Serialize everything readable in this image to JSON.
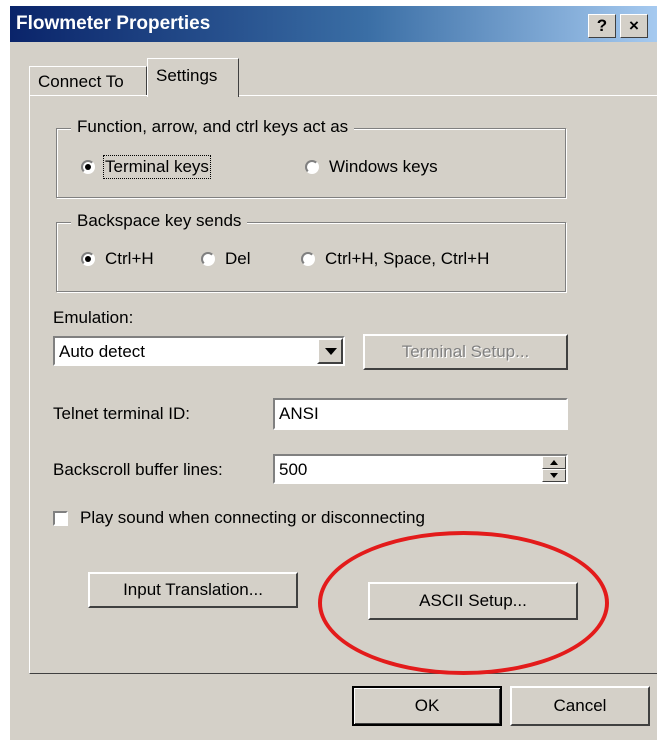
{
  "window": {
    "title": "Flowmeter Properties",
    "help_glyph": "?",
    "close_glyph": "×"
  },
  "tabs": [
    {
      "label": "Connect To",
      "active": false
    },
    {
      "label": "Settings",
      "active": true
    }
  ],
  "keys_group": {
    "legend": "Function, arrow, and ctrl keys act as",
    "options": [
      {
        "label": "Terminal keys",
        "accel": "T",
        "selected": true
      },
      {
        "label": "Windows keys",
        "accel": "W",
        "selected": false
      }
    ]
  },
  "backspace_group": {
    "legend": "Backspace key sends",
    "options": [
      {
        "label": "Ctrl+H",
        "selected": true
      },
      {
        "label": "Del",
        "selected": false
      },
      {
        "label": "Ctrl+H, Space, Ctrl+H",
        "selected": false
      }
    ]
  },
  "emulation": {
    "label": "Emulation:",
    "value": "Auto detect",
    "setup_button": "Terminal Setup..."
  },
  "telnet": {
    "label": "Telnet terminal ID:",
    "value": "ANSI"
  },
  "backscroll": {
    "label": "Backscroll buffer lines:",
    "value": "500"
  },
  "sound": {
    "label": "Play sound when connecting or disconnecting",
    "checked": false
  },
  "buttons": {
    "input_translation": "Input Translation...",
    "ascii_setup": "ASCII Setup...",
    "ok": "OK",
    "cancel": "Cancel"
  },
  "colors": {
    "titlebar_start": "#0a246a",
    "titlebar_end": "#a6caf0",
    "annotation": "#e31b1b",
    "face": "#d4d0c8"
  }
}
